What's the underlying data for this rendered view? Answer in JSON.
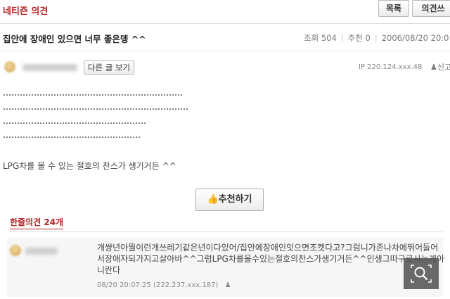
{
  "header": {
    "section_title": "네티즌 의견",
    "list_button": "목록",
    "write_button": "의견쓰"
  },
  "post": {
    "title": "집안에 장애인 있으면 너무 좋은뎅 ^^",
    "views_label": "조회",
    "views": "504",
    "recommend_label": "추천",
    "recommend": "0",
    "date": "2006/08/20 20:0",
    "other_posts_button": "다른 글 보기",
    "ip": "IP 220.124.xxx.48",
    "report_label": "신고",
    "body": "LPG차를 몰 수 있는 절호의 찬스가 생기거든 ^^",
    "recommend_button": "추천하기"
  },
  "comments_header": "한줄의견 24개",
  "comments": [
    {
      "text": "개썅년아뭘이런개쓰레기같은년이다있어/집안에장애인잇으면조켓다고?그럼니가존나차에뛰어들어서장애자되가지고살아바^^그럼LPG차를몰수있는절호의찬스가생기거든^^인생그따구로사는게아니란다",
      "meta": "08/20 20:07:25 (222.237.xxx.187)"
    }
  ],
  "icons": {
    "report": "person-icon",
    "recommend": "thumbs-up-icon",
    "search": "search-icon"
  }
}
